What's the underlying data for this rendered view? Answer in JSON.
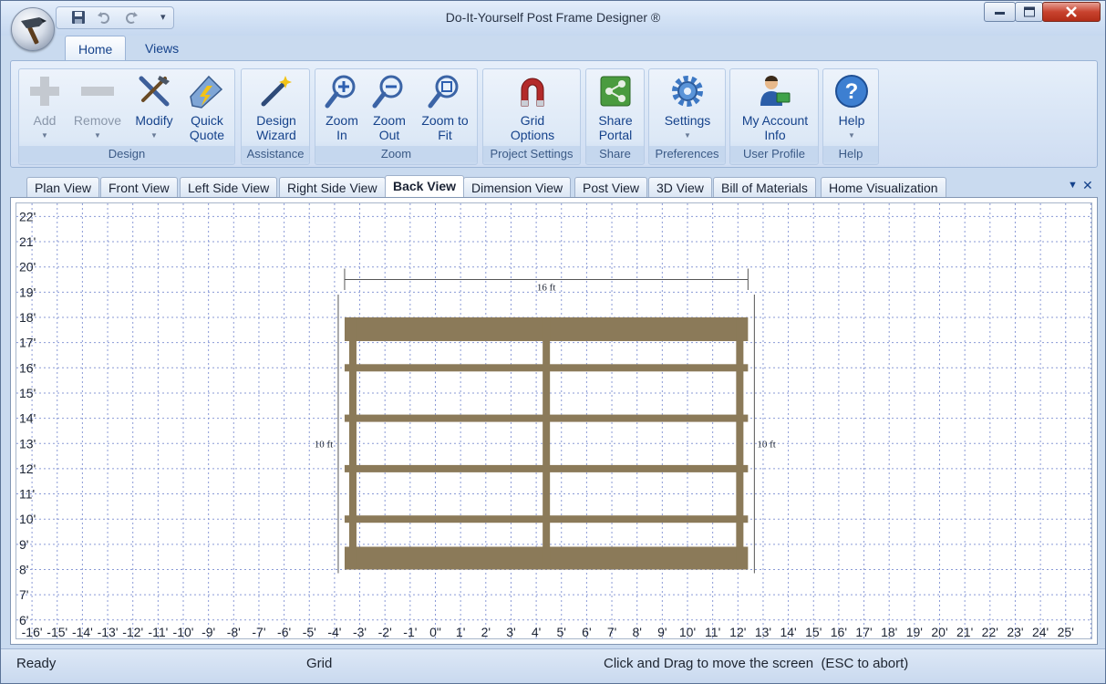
{
  "window": {
    "title": "Do-It-Yourself Post Frame Designer ®"
  },
  "qat": {
    "save_icon": "save-icon",
    "undo_icon": "undo-icon",
    "redo_icon": "redo-icon",
    "more": "▾"
  },
  "ribbon_tabs": [
    "Home",
    "Views"
  ],
  "ribbon_groups": {
    "design": {
      "label": "Design",
      "buttons": [
        {
          "label": "Add",
          "enabled": false,
          "dropdown": true
        },
        {
          "label": "Remove",
          "enabled": false,
          "dropdown": true
        },
        {
          "label": "Modify",
          "enabled": true,
          "dropdown": true
        },
        {
          "label1": "Quick",
          "label2": "Quote",
          "enabled": true
        }
      ]
    },
    "assistance": {
      "label": "Assistance",
      "button1": "Design",
      "button2": "Wizard"
    },
    "zoom": {
      "label": "Zoom",
      "zoom_in_1": "Zoom",
      "zoom_in_2": "In",
      "zoom_out_1": "Zoom",
      "zoom_out_2": "Out",
      "zoom_fit_1": "Zoom to",
      "zoom_fit_2": "Fit"
    },
    "project_settings": {
      "label": "Project Settings",
      "button1": "Grid",
      "button2": "Options"
    },
    "share": {
      "label": "Share",
      "button1": "Share",
      "button2": "Portal"
    },
    "preferences": {
      "label": "Preferences",
      "button": "Settings"
    },
    "user_profile": {
      "label": "User Profile",
      "button1": "My Account",
      "button2": "Info"
    },
    "help": {
      "label": "Help",
      "button": "Help"
    }
  },
  "doc_tabs": [
    "Plan View",
    "Front View",
    "Left Side View",
    "Right Side View",
    "Back View",
    "Dimension View",
    "Post View",
    "3D View",
    "Bill of Materials",
    "Home Visualization"
  ],
  "active_doc_tab": "Back View",
  "drawing": {
    "y_axis_labels": [
      "22'",
      "21'",
      "20'",
      "19'",
      "18'",
      "17'",
      "16'",
      "15'",
      "14'",
      "13'",
      "12'",
      "11'",
      "10'",
      "9'",
      "8'",
      "7'",
      "6'"
    ],
    "x_axis_labels": [
      "-16'",
      "-15'",
      "-14'",
      "-13'",
      "-12'",
      "-11'",
      "-10'",
      "-9'",
      "-8'",
      "-7'",
      "-6'",
      "-5'",
      "-4'",
      "-3'",
      "-2'",
      "-1'",
      "0\"",
      "1'",
      "2'",
      "3'",
      "4'",
      "5'",
      "6'",
      "7'",
      "8'",
      "9'",
      "10'",
      "11'",
      "12'",
      "13'",
      "14'",
      "15'",
      "16'",
      "17'",
      "18'",
      "19'",
      "20'",
      "21'",
      "22'",
      "23'",
      "24'",
      "25'"
    ],
    "width_dimension": "16 ft",
    "left_height_dimension": "10 ft",
    "right_height_dimension": "10 ft",
    "frame_color": "#8b7a59",
    "grid_color": "#8a9ad6"
  },
  "status": {
    "state": "Ready",
    "mode": "Grid",
    "hint": "Click and Drag to move the screen  (ESC to abort)"
  }
}
